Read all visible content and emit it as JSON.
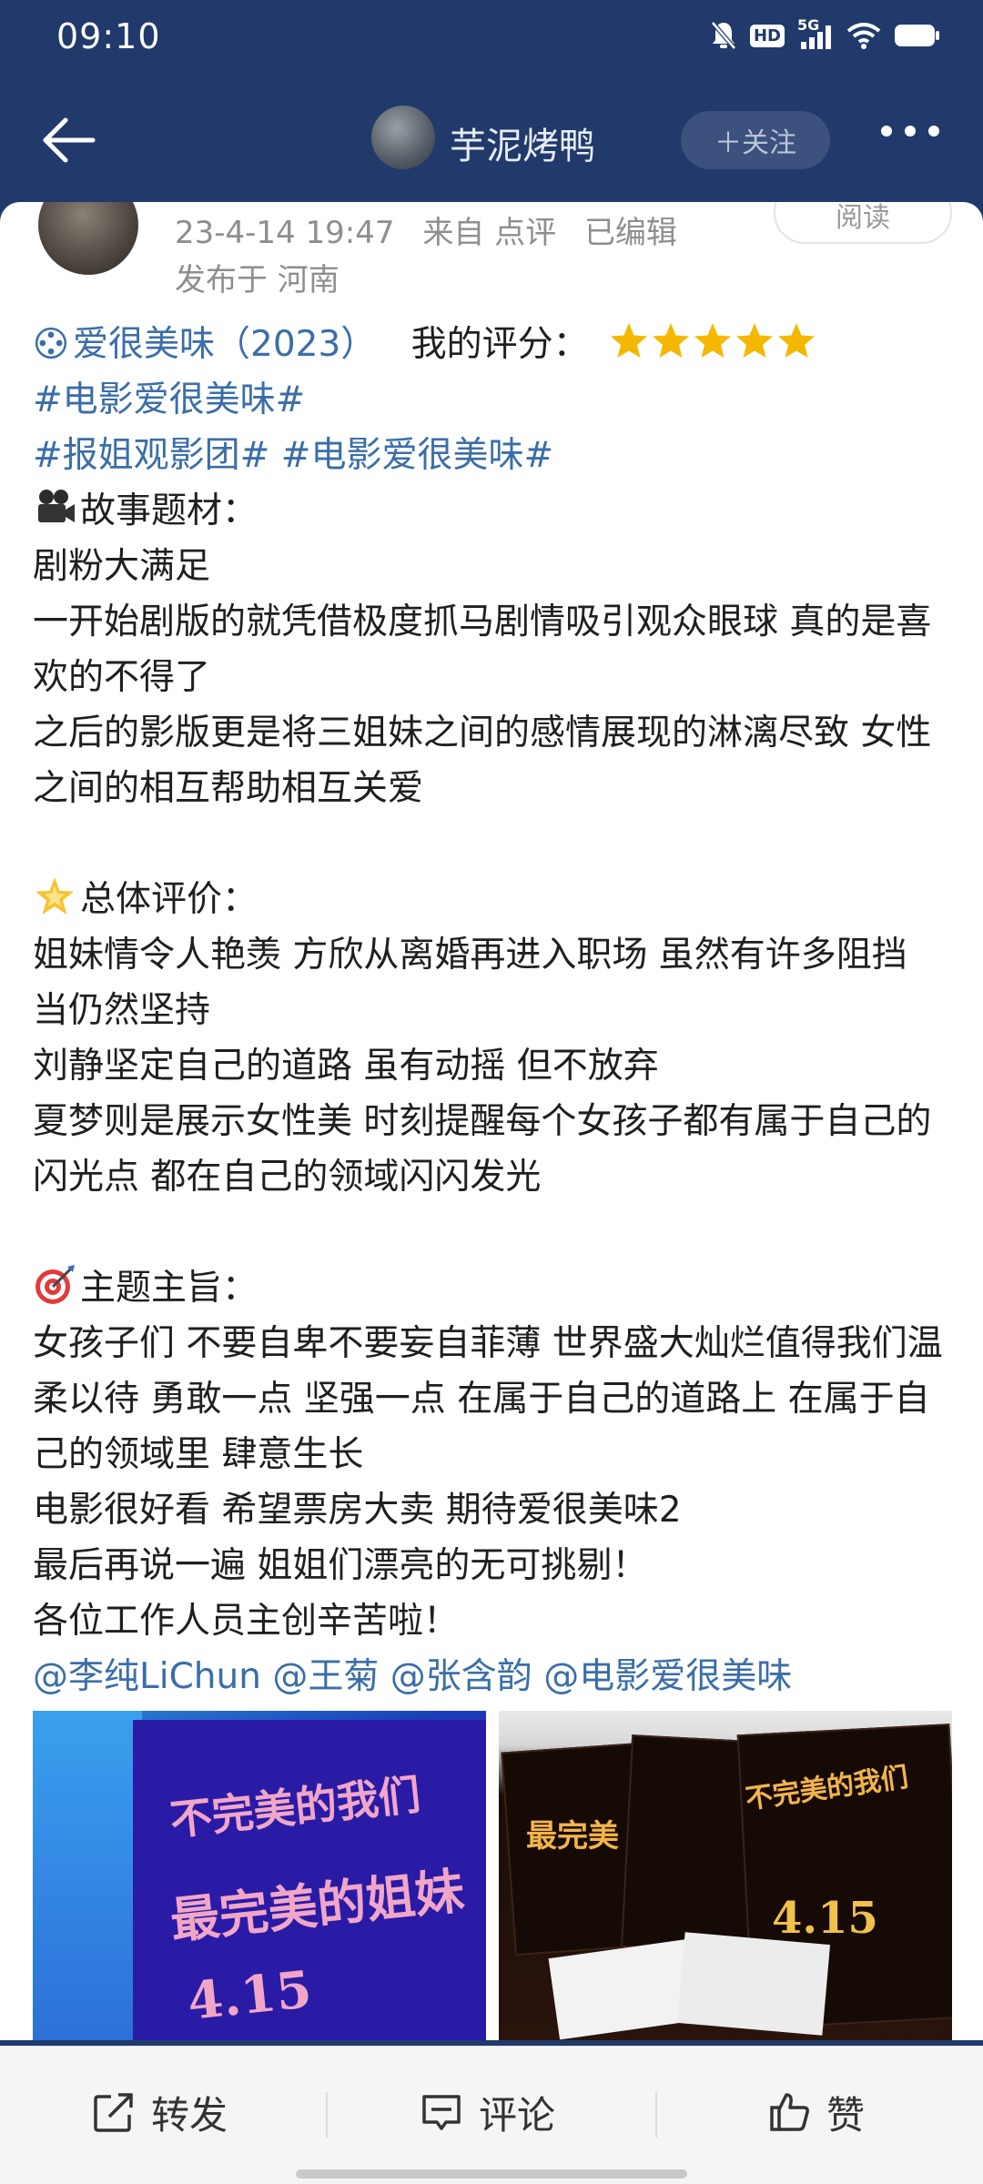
{
  "status": {
    "time": "09:10",
    "icons": [
      "mute-icon",
      "hd-icon",
      "5g-signal-icon",
      "wifi-icon",
      "battery-icon"
    ],
    "network": "5G",
    "hd": "HD"
  },
  "nav": {
    "title": "芋泥烤鸭",
    "follow_label": "＋关注",
    "back_icon": "back-arrow-icon",
    "more_icon": "more-dots-icon"
  },
  "post": {
    "read_label": "阅读",
    "time": "23-4-14 19:47",
    "source": "来自 点评",
    "edited": "已编辑",
    "location": "发布于 河南",
    "rating_topic": "爱很美味（2023）",
    "rating_label": "我的评分：",
    "rating_stars": 5,
    "hashtag1": "#电影爱很美味#",
    "hashtag2": "#报姐观影团#",
    "hashtag3": "#电影爱很美味#",
    "sec1_title": "故事题材：",
    "sec1_l1": "剧粉大满足",
    "sec1_p1": "一开始剧版的就凭借极度抓马剧情吸引观众眼球 真的是喜欢的不得了",
    "sec1_p2": "之后的影版更是将三姐妹之间的感情展现的淋漓尽致 女性之间的相互帮助相互关爱",
    "sec2_title": "总体评价：",
    "sec2_p1": "姐妹情令人艳羡 方欣从离婚再进入职场 虽然有许多阻挡 当仍然坚持",
    "sec2_l2": "刘静坚定自己的道路 虽有动摇 但不放弃",
    "sec2_p3": "夏梦则是展示女性美  时刻提醒每个女孩子都有属于自己的闪光点 都在自己的领域闪闪发光",
    "sec3_title": "主题主旨：",
    "sec3_p1": "女孩子们 不要自卑不要妄自菲薄 世界盛大灿烂值得我们温柔以待 勇敢一点 坚强一点 在属于自己的道路上 在属于自己的领域里 肆意生长",
    "sec3_l2": "电影很好看 希望票房大卖 期待爱很美味2",
    "sec3_l3": "最后再说一遍 姐姐们漂亮的无可挑剔！",
    "sec3_l4": "各位工作人员主创辛苦啦！",
    "mention1": "@李纯LiChun",
    "mention2": "@王菊",
    "mention3": "@张含韵",
    "mention4": "@电影爱很美味"
  },
  "images": {
    "img1_text_a": "不完美的我们",
    "img1_text_b": "最完美的姐妹",
    "img1_text_c": "4.15",
    "img2_text_a": "不完美的我们",
    "img2_text_b": "最完美",
    "img2_text_c": "4.15"
  },
  "actions": {
    "repost": "转发",
    "comment": "评论",
    "like": "赞"
  },
  "colors": {
    "nav_bg": "#213a6b",
    "link": "#3b6ea8",
    "star": "#f5b800"
  }
}
